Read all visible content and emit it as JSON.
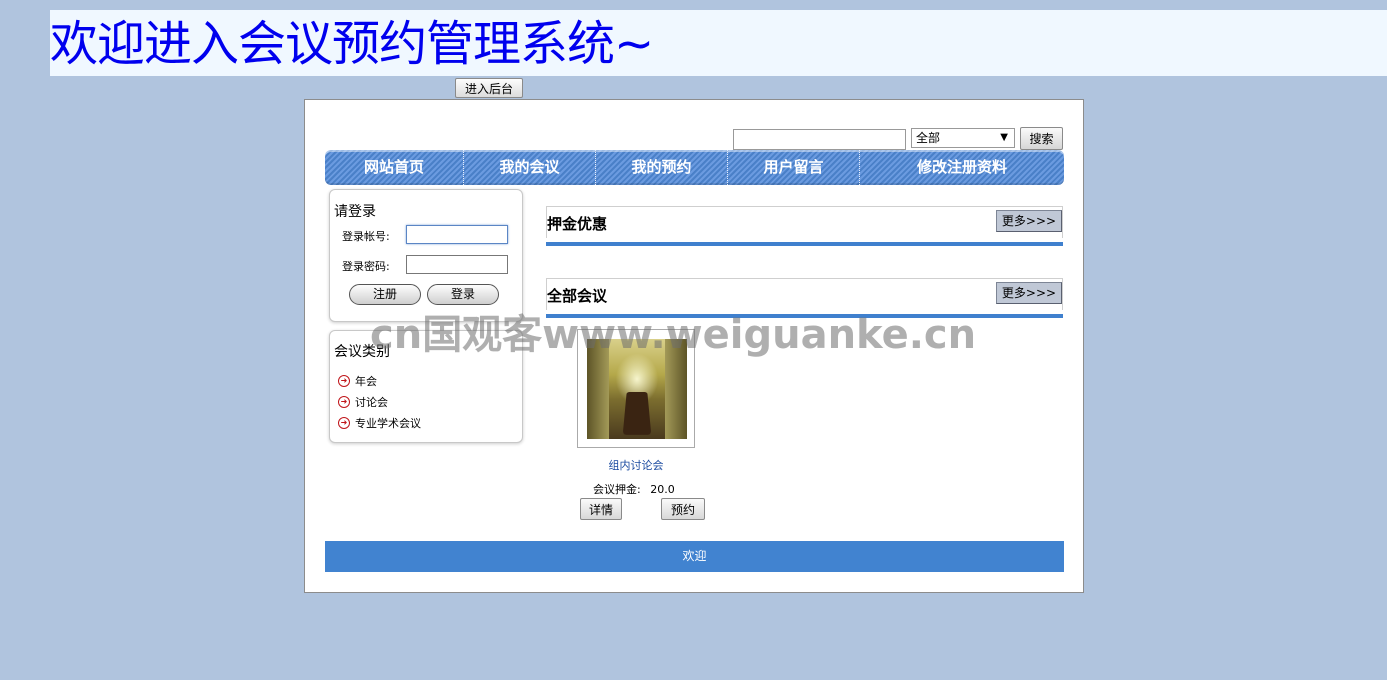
{
  "header": {
    "title": "欢迎进入会议预约管理系统~",
    "admin_button": "进入后台"
  },
  "search": {
    "placeholder": "",
    "category_selected": "全部",
    "button": "搜索"
  },
  "nav": {
    "items": [
      "网站首页",
      "我的会议",
      "我的预约",
      "用户留言",
      "修改注册资料"
    ]
  },
  "login": {
    "title": "请登录",
    "account_label": "登录帐号:",
    "password_label": "登录密码:",
    "register_button": "注册",
    "login_button": "登录"
  },
  "categories": {
    "title": "会议类别",
    "items": [
      "年会",
      "讨论会",
      "专业学术会议"
    ],
    "icon": "arrow-circle-icon"
  },
  "sections": {
    "deposit": {
      "title": "押金优惠",
      "more": "更多>>>"
    },
    "all_meetings": {
      "title": "全部会议",
      "more": "更多>>>"
    }
  },
  "meetings": [
    {
      "name": "组内讨论会",
      "deposit_label": "会议押金:",
      "deposit_value": "20.0",
      "detail_button": "详情",
      "book_button": "预约"
    }
  ],
  "footer": {
    "text": "欢迎"
  },
  "watermark": "cn国观客www.weiguanke.cn",
  "colors": {
    "page_bg": "#b0c4de",
    "banner_bg": "#f0f8ff",
    "title_text": "#0000ee",
    "accent_blue": "#4183d0"
  }
}
